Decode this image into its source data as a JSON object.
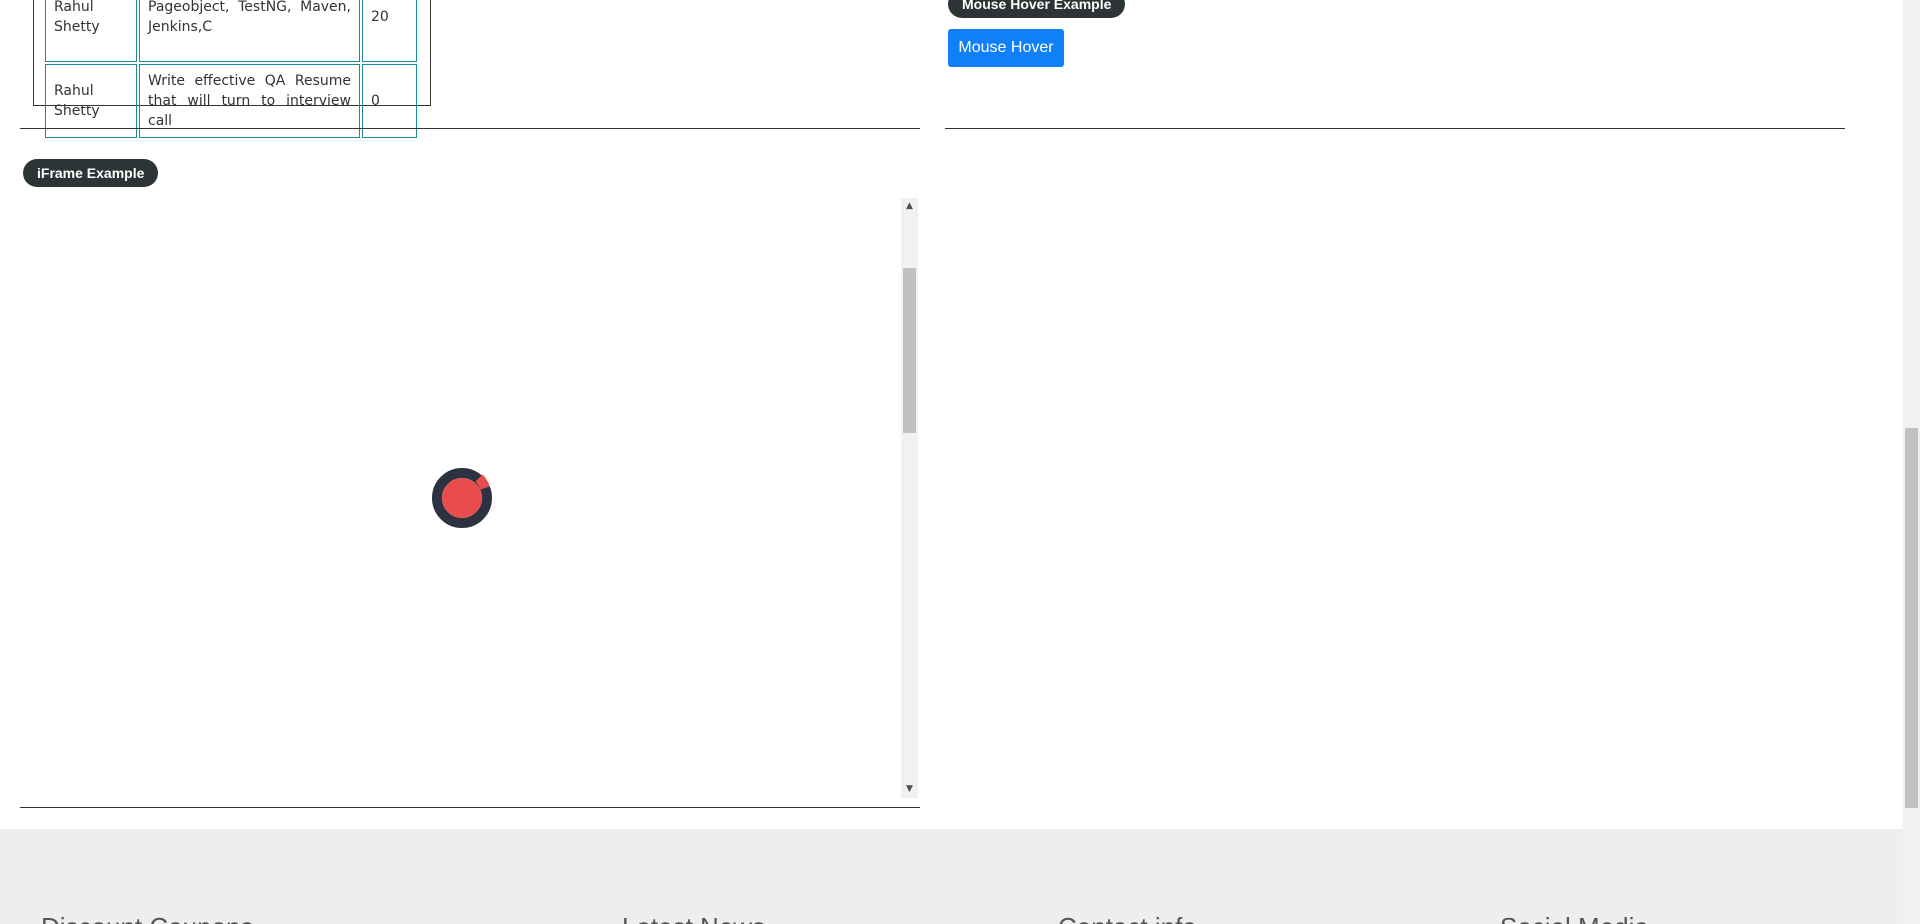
{
  "web_table": {
    "rows": [
      {
        "instructor": "Rahul Shetty",
        "course": "Pageobject, TestNG, Maven, Jenkins,C",
        "price": "20"
      },
      {
        "instructor": "Rahul Shetty",
        "course": "Write effective QA Resume that will turn to interview call",
        "price": "0"
      }
    ]
  },
  "mouse_hover": {
    "legend": "Mouse Hover Example",
    "button_label": "Mouse Hover"
  },
  "iframe": {
    "legend": "iFrame Example",
    "scroll_up": "▲",
    "scroll_down": "▼"
  },
  "footer": {
    "headings": [
      "Discount Coupons",
      "Latest News",
      "Contact info",
      "Social Media"
    ]
  },
  "colors": {
    "legend_bg": "#2c3436",
    "button_bg": "#0f80fa",
    "table_border": "#1a8a9a",
    "loader_red": "#e84c4c",
    "loader_ring": "#2d3240",
    "footer_bg": "#eeeeee"
  },
  "icons": {
    "loader": "spinner-icon"
  }
}
